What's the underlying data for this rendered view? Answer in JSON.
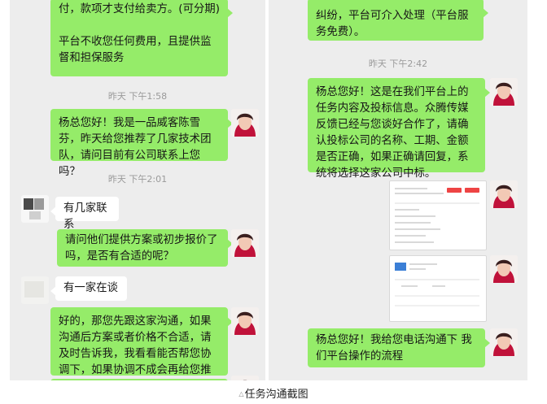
{
  "left": {
    "msg_top": "付，款项才支付给卖方。(可分期)\n\n平台不收您任何费用，且提供监督和担保服务",
    "ts1": "昨天 下午1:58",
    "msg_intro": "杨总您好！我是一品威客陈雪芬，昨天给您推荐了几家技术团队，请问目前有公司联系上您吗？",
    "ts2": "昨天 下午2:01",
    "reply1": "有几家联系",
    "msg_ask": "请问他们提供方案或初步报价了吗，是否有合适的呢？",
    "reply2": "有一家在谈",
    "msg_follow": "好的，那您先跟这家沟通，如果沟通后方案或者价格不合适，请及时告诉我，我看看能否帮您协调下，如果协调不成会再给您推荐哦。"
  },
  "right": {
    "msg_top": "纠纷，平台可介入处理（平台服务免费）。",
    "ts1": "昨天 下午2:42",
    "msg_task": "杨总您好！这是在我们平台上的任务内容及投标信息。众腾传媒反馈已经与您谈好合作了，请确认投标公司的名称、工期、金额是否正确，如果正确请回复，系统将选择这家公司中标。",
    "msg_call": "杨总您好！我给您电话沟通下 我们平台操作的流程"
  },
  "caption": "任务沟通截图",
  "colors": {
    "bubble_green": "#95ec69",
    "bubble_white": "#ffffff",
    "chat_bg": "#ededed"
  }
}
